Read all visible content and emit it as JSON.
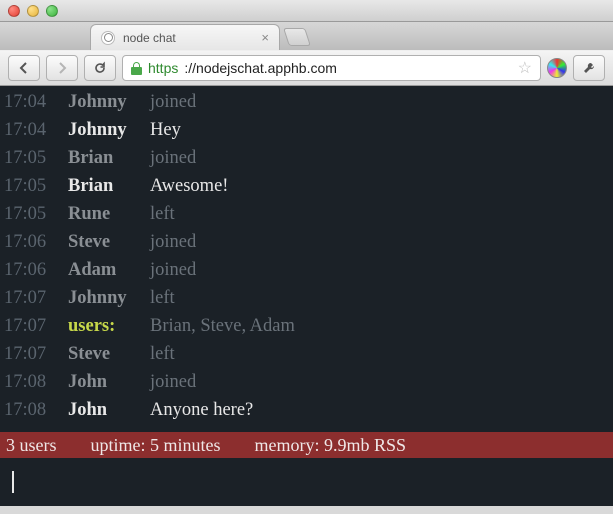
{
  "window": {
    "tab_title": "node chat",
    "url_scheme": "https",
    "url_host": "://nodejschat.apphb.com"
  },
  "log": [
    {
      "time": "17:04",
      "nick": "Johnny",
      "text": "joined",
      "kind": "join"
    },
    {
      "time": "17:04",
      "nick": "Johnny",
      "text": "Hey",
      "kind": "msg"
    },
    {
      "time": "17:05",
      "nick": "Brian",
      "text": "joined",
      "kind": "join"
    },
    {
      "time": "17:05",
      "nick": "Brian",
      "text": "Awesome!",
      "kind": "msg"
    },
    {
      "time": "17:05",
      "nick": "Rune",
      "text": "left",
      "kind": "left"
    },
    {
      "time": "17:06",
      "nick": "Steve",
      "text": "joined",
      "kind": "join"
    },
    {
      "time": "17:06",
      "nick": "Adam",
      "text": "joined",
      "kind": "join"
    },
    {
      "time": "17:07",
      "nick": "Johnny",
      "text": "left",
      "kind": "left"
    },
    {
      "time": "17:07",
      "nick": "users:",
      "text": "Brian, Steve, Adam",
      "kind": "users"
    },
    {
      "time": "17:07",
      "nick": "Steve",
      "text": "left",
      "kind": "left"
    },
    {
      "time": "17:08",
      "nick": "John",
      "text": "joined",
      "kind": "join"
    },
    {
      "time": "17:08",
      "nick": "John",
      "text": "Anyone here?",
      "kind": "msg"
    }
  ],
  "status": {
    "users": "3 users",
    "uptime": "uptime: 5 minutes",
    "memory": "memory: 9.9mb RSS"
  }
}
